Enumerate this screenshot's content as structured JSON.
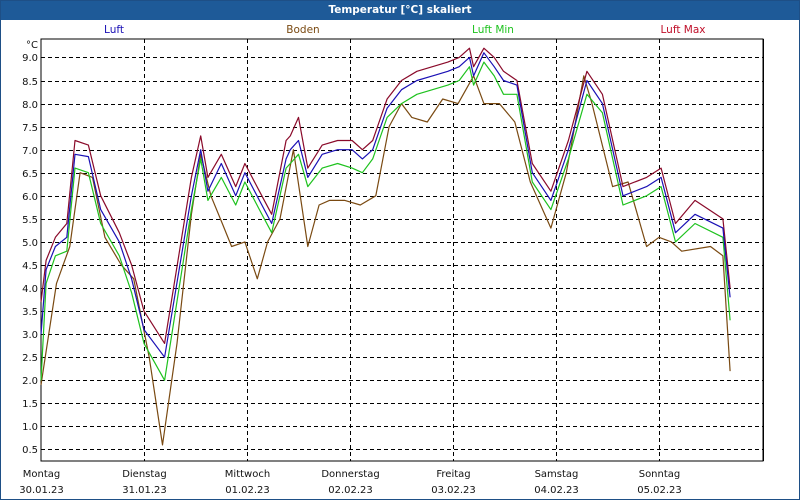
{
  "window": {
    "title": "Temperatur [°C] skaliert"
  },
  "chart_data": {
    "type": "line",
    "title": "Temperatur [°C] skaliert",
    "ylabel": "°C",
    "ylim": [
      0.25,
      9.4
    ],
    "yticks": [
      "0.5",
      "1.0",
      "1.5",
      "2.0",
      "2.5",
      "3.0",
      "3.5",
      "4.0",
      "4.5",
      "5.0",
      "5.5",
      "6.0",
      "6.5",
      "7.0",
      "7.5",
      "8.0",
      "8.5",
      "9.0"
    ],
    "xlim": [
      0,
      7.0
    ],
    "x_days": [
      {
        "day": "Montag",
        "date": "30.01.23"
      },
      {
        "day": "Dienstag",
        "date": "31.01.23"
      },
      {
        "day": "Mittwoch",
        "date": "01.02.23"
      },
      {
        "day": "Donnerstag",
        "date": "02.02.23"
      },
      {
        "day": "Freitag",
        "date": "03.02.23"
      },
      {
        "day": "Samstag",
        "date": "04.02.23"
      },
      {
        "day": "Sonntag",
        "date": "05.02.23"
      }
    ],
    "grid": true,
    "legend_position": "top",
    "colors": {
      "luft": "#1a10b5",
      "boden": "#7a4a12",
      "luft_min": "#1ec21e",
      "luft_max": "#8a0a2a"
    },
    "series": [
      {
        "name": "Luft",
        "key": "luft",
        "color": "#1a10b5",
        "points": [
          [
            0,
            3.0
          ],
          [
            0.05,
            4.4
          ],
          [
            0.14,
            4.9
          ],
          [
            0.25,
            5.1
          ],
          [
            0.33,
            6.9
          ],
          [
            0.46,
            6.85
          ],
          [
            0.58,
            5.7
          ],
          [
            0.76,
            5.0
          ],
          [
            0.88,
            4.2
          ],
          [
            1.0,
            3.1
          ],
          [
            1.2,
            2.5
          ],
          [
            1.46,
            6.0
          ],
          [
            1.55,
            7.0
          ],
          [
            1.62,
            6.1
          ],
          [
            1.75,
            6.7
          ],
          [
            1.89,
            6.0
          ],
          [
            1.98,
            6.5
          ],
          [
            2.12,
            5.9
          ],
          [
            2.24,
            5.4
          ],
          [
            2.38,
            6.8
          ],
          [
            2.42,
            7.0
          ],
          [
            2.5,
            7.2
          ],
          [
            2.59,
            6.4
          ],
          [
            2.73,
            6.9
          ],
          [
            2.88,
            7.0
          ],
          [
            3.02,
            7.0
          ],
          [
            3.12,
            6.8
          ],
          [
            3.22,
            7.0
          ],
          [
            3.36,
            7.9
          ],
          [
            3.5,
            8.3
          ],
          [
            3.65,
            8.5
          ],
          [
            3.8,
            8.6
          ],
          [
            3.95,
            8.7
          ],
          [
            4.06,
            8.8
          ],
          [
            4.16,
            9.0
          ],
          [
            4.2,
            8.6
          ],
          [
            4.3,
            9.1
          ],
          [
            4.4,
            8.8
          ],
          [
            4.49,
            8.5
          ],
          [
            4.62,
            8.4
          ],
          [
            4.77,
            6.5
          ],
          [
            4.95,
            5.9
          ],
          [
            5.12,
            7.0
          ],
          [
            5.3,
            8.5
          ],
          [
            5.45,
            8.0
          ],
          [
            5.65,
            6.0
          ],
          [
            5.88,
            6.2
          ],
          [
            6.02,
            6.4
          ],
          [
            6.16,
            5.2
          ],
          [
            6.35,
            5.6
          ],
          [
            6.62,
            5.3
          ],
          [
            6.69,
            3.8
          ]
        ]
      },
      {
        "name": "Boden",
        "key": "boden",
        "color": "#7a4a12",
        "points": [
          [
            0,
            1.9
          ],
          [
            0.15,
            4.1
          ],
          [
            0.28,
            4.9
          ],
          [
            0.38,
            6.5
          ],
          [
            0.5,
            6.4
          ],
          [
            0.62,
            5.1
          ],
          [
            0.78,
            4.5
          ],
          [
            0.9,
            4.2
          ],
          [
            1.05,
            2.5
          ],
          [
            1.18,
            0.6
          ],
          [
            1.32,
            2.8
          ],
          [
            1.46,
            5.6
          ],
          [
            1.55,
            6.9
          ],
          [
            1.65,
            6.0
          ],
          [
            1.76,
            5.4
          ],
          [
            1.85,
            4.9
          ],
          [
            1.98,
            5.0
          ],
          [
            2.1,
            4.2
          ],
          [
            2.2,
            5.0
          ],
          [
            2.32,
            5.5
          ],
          [
            2.45,
            7.0
          ],
          [
            2.59,
            4.9
          ],
          [
            2.7,
            5.8
          ],
          [
            2.8,
            5.9
          ],
          [
            2.95,
            5.9
          ],
          [
            3.1,
            5.8
          ],
          [
            3.25,
            6.0
          ],
          [
            3.38,
            7.5
          ],
          [
            3.5,
            8.0
          ],
          [
            3.6,
            7.7
          ],
          [
            3.75,
            7.6
          ],
          [
            3.9,
            8.1
          ],
          [
            4.05,
            8.0
          ],
          [
            4.2,
            8.6
          ],
          [
            4.3,
            8.0
          ],
          [
            4.45,
            8.0
          ],
          [
            4.6,
            7.6
          ],
          [
            4.75,
            6.3
          ],
          [
            4.95,
            5.3
          ],
          [
            5.1,
            6.5
          ],
          [
            5.27,
            8.6
          ],
          [
            5.35,
            8.0
          ],
          [
            5.55,
            6.2
          ],
          [
            5.7,
            6.3
          ],
          [
            5.88,
            4.9
          ],
          [
            6.0,
            5.1
          ],
          [
            6.12,
            5.0
          ],
          [
            6.22,
            4.8
          ],
          [
            6.5,
            4.9
          ],
          [
            6.62,
            4.7
          ],
          [
            6.69,
            2.2
          ]
        ]
      },
      {
        "name": "Luft Min",
        "key": "luft_min",
        "color": "#1ec21e",
        "points": [
          [
            0,
            2.0
          ],
          [
            0.05,
            4.1
          ],
          [
            0.14,
            4.7
          ],
          [
            0.25,
            4.8
          ],
          [
            0.33,
            6.6
          ],
          [
            0.46,
            6.5
          ],
          [
            0.58,
            5.4
          ],
          [
            0.76,
            4.7
          ],
          [
            0.88,
            3.9
          ],
          [
            1.0,
            2.8
          ],
          [
            1.2,
            2.0
          ],
          [
            1.46,
            5.7
          ],
          [
            1.55,
            6.8
          ],
          [
            1.62,
            5.9
          ],
          [
            1.75,
            6.4
          ],
          [
            1.89,
            5.8
          ],
          [
            1.98,
            6.3
          ],
          [
            2.12,
            5.7
          ],
          [
            2.24,
            5.2
          ],
          [
            2.38,
            6.6
          ],
          [
            2.42,
            6.7
          ],
          [
            2.5,
            6.9
          ],
          [
            2.59,
            6.2
          ],
          [
            2.73,
            6.6
          ],
          [
            2.88,
            6.7
          ],
          [
            3.02,
            6.6
          ],
          [
            3.12,
            6.5
          ],
          [
            3.22,
            6.8
          ],
          [
            3.36,
            7.7
          ],
          [
            3.5,
            8.0
          ],
          [
            3.65,
            8.2
          ],
          [
            3.8,
            8.3
          ],
          [
            3.95,
            8.4
          ],
          [
            4.06,
            8.5
          ],
          [
            4.16,
            8.8
          ],
          [
            4.2,
            8.4
          ],
          [
            4.3,
            8.9
          ],
          [
            4.4,
            8.6
          ],
          [
            4.49,
            8.2
          ],
          [
            4.62,
            8.2
          ],
          [
            4.77,
            6.3
          ],
          [
            4.95,
            5.7
          ],
          [
            5.12,
            6.8
          ],
          [
            5.3,
            8.2
          ],
          [
            5.45,
            7.8
          ],
          [
            5.65,
            5.8
          ],
          [
            5.88,
            6.0
          ],
          [
            6.02,
            6.2
          ],
          [
            6.16,
            5.0
          ],
          [
            6.35,
            5.4
          ],
          [
            6.62,
            5.1
          ],
          [
            6.69,
            3.3
          ]
        ]
      },
      {
        "name": "Luft Max",
        "key": "luft_max",
        "color": "#8a0a2a",
        "points": [
          [
            0,
            3.7
          ],
          [
            0.05,
            4.6
          ],
          [
            0.14,
            5.1
          ],
          [
            0.25,
            5.4
          ],
          [
            0.33,
            7.2
          ],
          [
            0.46,
            7.1
          ],
          [
            0.58,
            6.0
          ],
          [
            0.76,
            5.2
          ],
          [
            0.88,
            4.5
          ],
          [
            1.0,
            3.5
          ],
          [
            1.2,
            2.8
          ],
          [
            1.46,
            6.4
          ],
          [
            1.55,
            7.3
          ],
          [
            1.62,
            6.4
          ],
          [
            1.75,
            6.9
          ],
          [
            1.89,
            6.2
          ],
          [
            1.98,
            6.7
          ],
          [
            2.12,
            6.1
          ],
          [
            2.24,
            5.6
          ],
          [
            2.38,
            7.2
          ],
          [
            2.42,
            7.3
          ],
          [
            2.5,
            7.7
          ],
          [
            2.59,
            6.6
          ],
          [
            2.73,
            7.1
          ],
          [
            2.88,
            7.2
          ],
          [
            3.02,
            7.2
          ],
          [
            3.12,
            7.0
          ],
          [
            3.22,
            7.2
          ],
          [
            3.36,
            8.1
          ],
          [
            3.5,
            8.5
          ],
          [
            3.65,
            8.7
          ],
          [
            3.8,
            8.8
          ],
          [
            3.95,
            8.9
          ],
          [
            4.06,
            9.0
          ],
          [
            4.16,
            9.2
          ],
          [
            4.2,
            8.8
          ],
          [
            4.3,
            9.2
          ],
          [
            4.4,
            9.0
          ],
          [
            4.49,
            8.7
          ],
          [
            4.62,
            8.5
          ],
          [
            4.77,
            6.7
          ],
          [
            4.95,
            6.1
          ],
          [
            5.12,
            7.2
          ],
          [
            5.3,
            8.7
          ],
          [
            5.45,
            8.2
          ],
          [
            5.65,
            6.2
          ],
          [
            5.88,
            6.4
          ],
          [
            6.02,
            6.6
          ],
          [
            6.16,
            5.4
          ],
          [
            6.35,
            5.9
          ],
          [
            6.62,
            5.5
          ],
          [
            6.69,
            4.0
          ]
        ]
      }
    ]
  }
}
